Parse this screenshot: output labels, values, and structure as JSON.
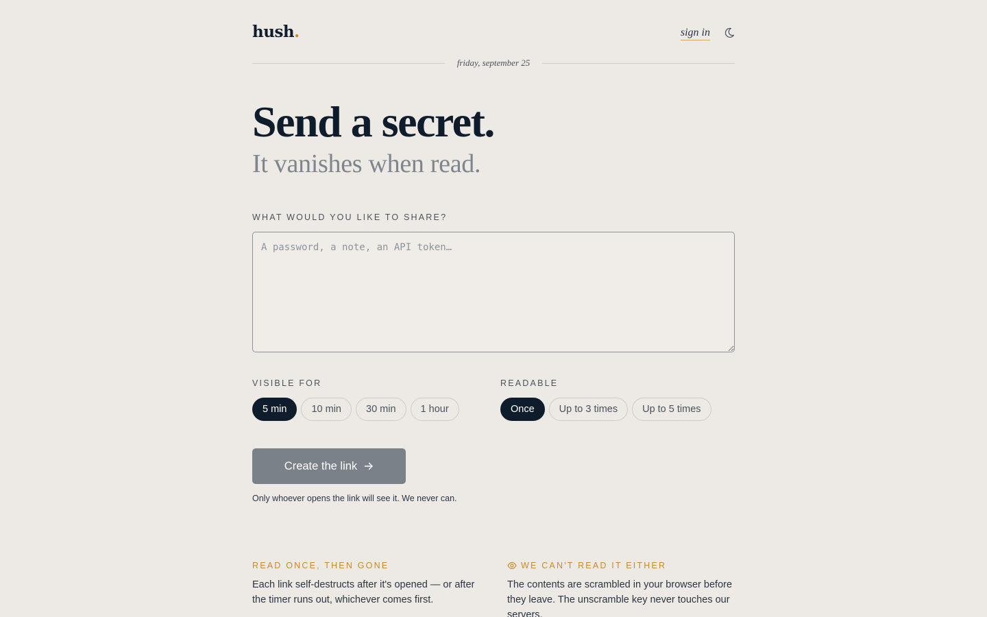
{
  "header": {
    "logo_text": "hush",
    "logo_dot": ".",
    "signin_label": "sign in",
    "theme_icon": "moon-icon",
    "date": "friday, september 25"
  },
  "hero": {
    "title_prefix": "Send a ",
    "title_highlight": "secret",
    "title_suffix": ".",
    "subtitle": "It vanishes when read."
  },
  "form": {
    "share_label": "WHAT WOULD YOU LIKE TO SHARE?",
    "secret_placeholder": "A password, a note, an API token…",
    "secret_value": "",
    "visible_for": {
      "label": "VISIBLE FOR",
      "options": [
        "5 min",
        "10 min",
        "30 min",
        "1 hour"
      ],
      "selected": "5 min"
    },
    "readable": {
      "label": "READABLE",
      "options": [
        "Once",
        "Up to 3 times",
        "Up to 5 times"
      ],
      "selected": "Once"
    },
    "submit_label": "Create the link",
    "submit_icon": "arrow-right-icon",
    "note": "Only whoever opens the link will see it. We never can."
  },
  "features": [
    {
      "title": "READ ONCE, THEN GONE",
      "body": "Each link self-destructs after it's opened — or after the timer runs out, whichever comes first."
    },
    {
      "icon": "eye-icon",
      "title": "WE CAN'T READ IT EITHER",
      "body": "The contents are scrambled in your browser before they leave. The unscramble key never touches our servers."
    }
  ],
  "colors": {
    "background": "#edeae6",
    "ink": "#0f1c2b",
    "accent": "#c98a2b",
    "muted": "#7f858c",
    "button_disabled": "#7b8188"
  }
}
